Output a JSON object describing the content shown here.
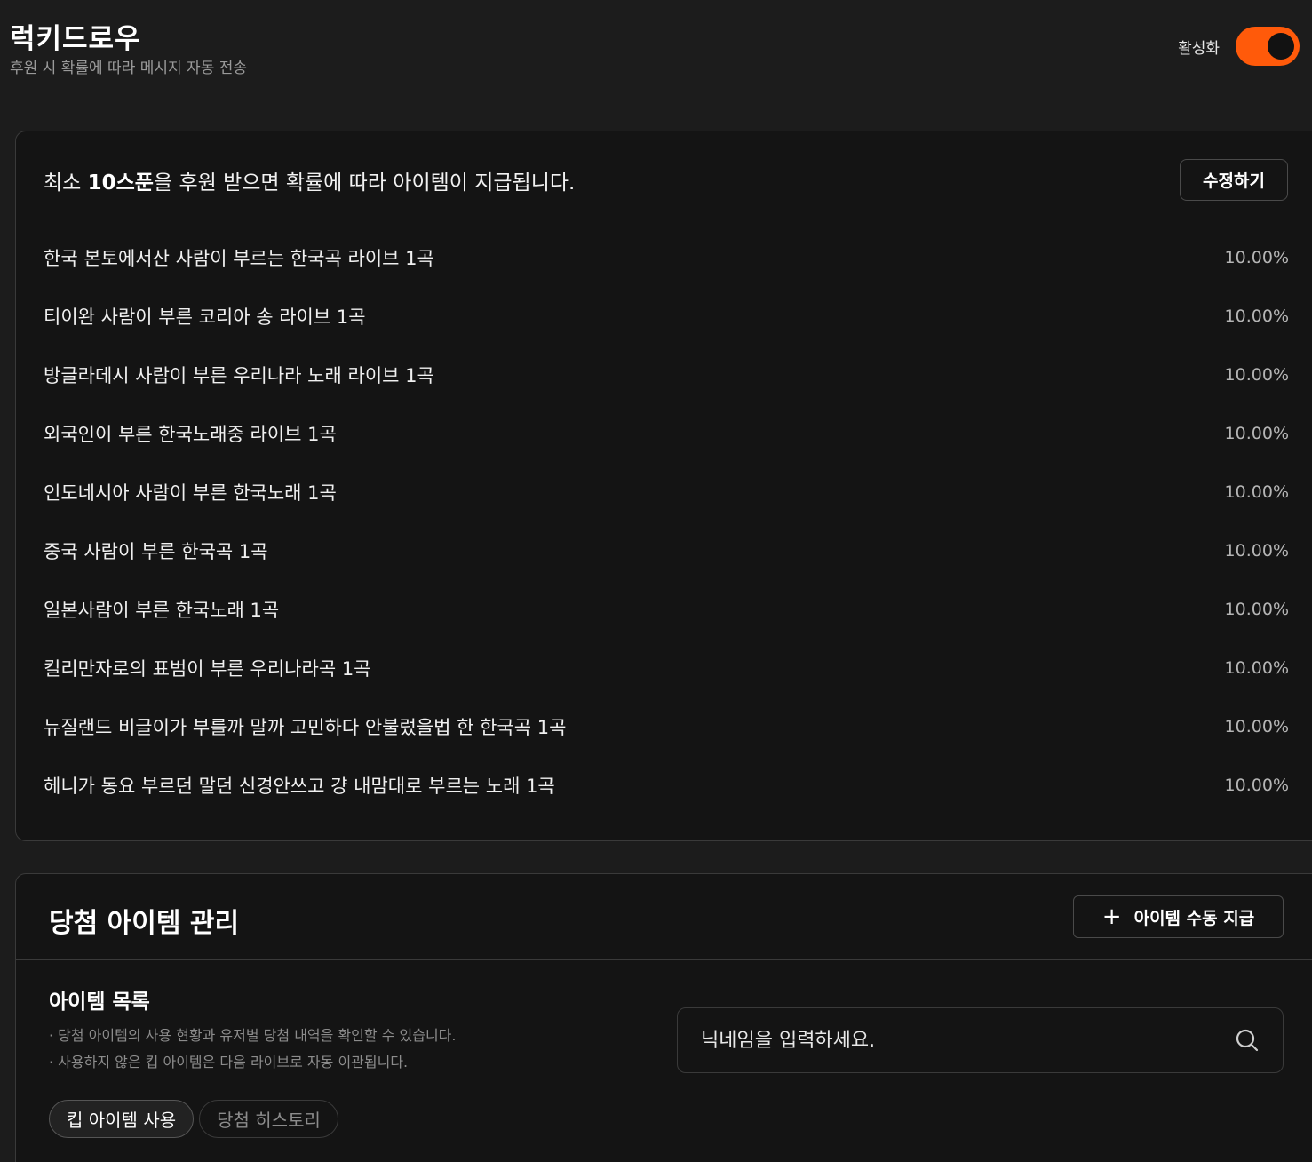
{
  "header": {
    "title": "럭키드로우",
    "subtitle": "후원 시 확률에 따라 메시지 자동 전송",
    "toggle_label": "활성화",
    "toggle_on": true,
    "accent_color": "#ff5a0a"
  },
  "rules_card": {
    "headline_prefix": "최소 ",
    "headline_amount": "10스푼",
    "headline_suffix": "을 후원 받으면 확률에 따라 아이템이 지급됩니다.",
    "edit_label": "수정하기",
    "items": [
      {
        "name": "한국 본토에서산 사람이 부르는 한국곡 라이브 1곡",
        "probability": "10.00%"
      },
      {
        "name": "티이완 사람이 부른 코리아 송 라이브 1곡",
        "probability": "10.00%"
      },
      {
        "name": "방글라데시 사람이 부른 우리나라 노래 라이브 1곡",
        "probability": "10.00%"
      },
      {
        "name": "외국인이 부른 한국노래중 라이브 1곡",
        "probability": "10.00%"
      },
      {
        "name": "인도네시아 사람이 부른 한국노래 1곡",
        "probability": "10.00%"
      },
      {
        "name": "중국 사람이 부른 한국곡 1곡",
        "probability": "10.00%"
      },
      {
        "name": "일본사람이 부른 한국노래 1곡",
        "probability": "10.00%"
      },
      {
        "name": "킬리만자로의 표범이 부른 우리나라곡 1곡",
        "probability": "10.00%"
      },
      {
        "name": "뉴질랜드 비글이가 부를까 말까 고민하다 안불렀을법 한 한국곡 1곡",
        "probability": "10.00%"
      },
      {
        "name": "헤니가 동요 부르던 말던 신경안쓰고 걍 내맘대로 부르는 노래 1곡",
        "probability": "10.00%"
      }
    ]
  },
  "management": {
    "title": "당첨 아이템 관리",
    "manual_grant_label": "아이템 수동 지급",
    "manual_grant_icon": "plus-icon",
    "list_title": "아이템 목록",
    "notes": [
      "· 당첨 아이템의 사용 현황과 유저별 당첨 내역을 확인할 수 있습니다.",
      "· 사용하지 않은 킵 아이템은 다음 라이브로 자동 이관됩니다."
    ],
    "search": {
      "placeholder": "닉네임을 입력하세요.",
      "value": "",
      "icon": "search-icon"
    },
    "tabs": [
      {
        "label": "킵 아이템 사용",
        "active": true
      },
      {
        "label": "당첨 히스토리",
        "active": false
      }
    ]
  }
}
